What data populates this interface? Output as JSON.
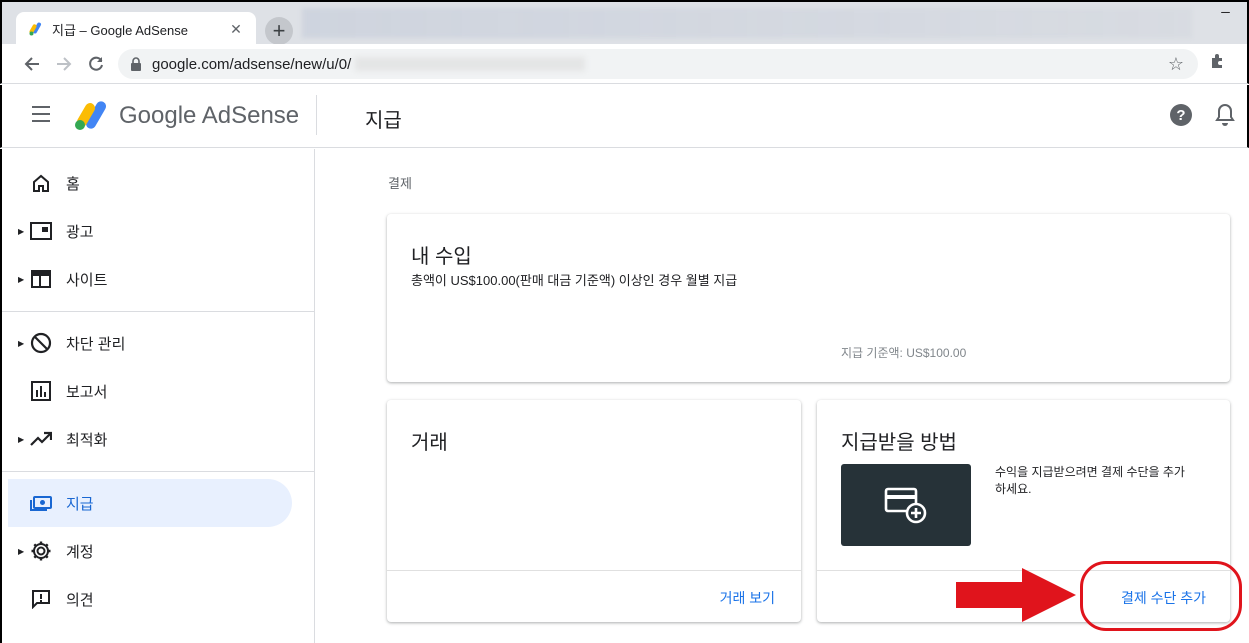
{
  "browser": {
    "tab_title": "지급 – Google AdSense",
    "tab_close": "✕",
    "new_tab": "+",
    "url": "google.com/adsense/new/u/0/",
    "window_control": "─"
  },
  "header": {
    "brand_google": "Google",
    "brand_adsense": "AdSense",
    "page_title": "지급",
    "help_symbol": "?"
  },
  "sidebar": {
    "items": [
      {
        "label": "홈",
        "icon": "home-icon"
      },
      {
        "label": "광고",
        "icon": "ads-icon"
      },
      {
        "label": "사이트",
        "icon": "sites-icon"
      },
      {
        "label": "차단 관리",
        "icon": "block-icon"
      },
      {
        "label": "보고서",
        "icon": "reports-icon"
      },
      {
        "label": "최적화",
        "icon": "trending-up-icon"
      },
      {
        "label": "지급",
        "icon": "payments-icon"
      },
      {
        "label": "계정",
        "icon": "gear-icon"
      },
      {
        "label": "의견",
        "icon": "feedback-icon"
      }
    ]
  },
  "main": {
    "breadcrumb": "결제",
    "earnings": {
      "title": "내 수입",
      "description": "총액이 US$100.00(판매 대금 기준액) 이상인 경우 월별 지급",
      "threshold": "지급 기준액: US$100.00"
    },
    "transactions": {
      "title": "거래",
      "link": "거래 보기"
    },
    "payment_method": {
      "title": "지급받을 방법",
      "description": "수익을 지급받으려면 결제 수단을 추가하세요.",
      "link": "결제 수단 추가"
    }
  },
  "colors": {
    "accent": "#1a73e8",
    "active_bg": "#e8f0fe",
    "annotation_red": "#e0141c",
    "card_image_bg": "#263238"
  }
}
